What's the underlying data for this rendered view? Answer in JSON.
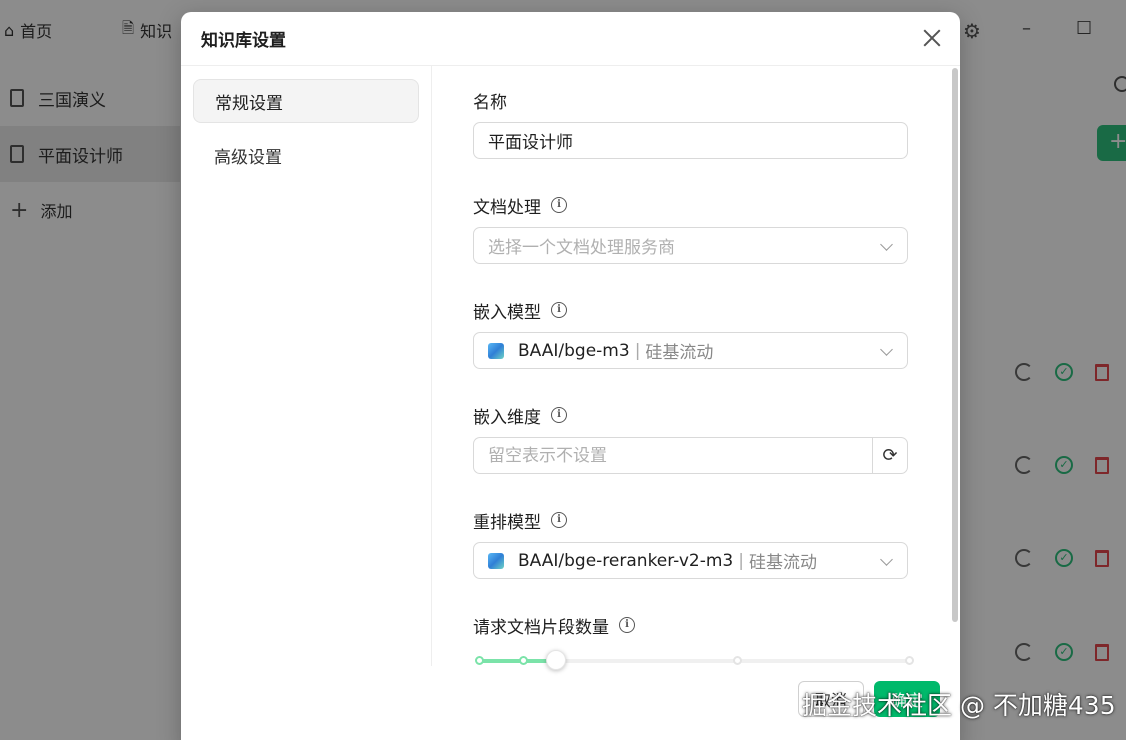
{
  "background": {
    "tabs": [
      {
        "label": "首页"
      },
      {
        "label": "知识"
      }
    ],
    "knowledge_bases": [
      {
        "label": "三国演义"
      },
      {
        "label": "平面设计师"
      }
    ],
    "add_label": "添加",
    "window_controls": {
      "minimize": "–",
      "maximize": "☐"
    }
  },
  "modal": {
    "title": "知识库设置",
    "nav": [
      {
        "label": "常规设置",
        "active": true
      },
      {
        "label": "高级设置",
        "active": false
      }
    ],
    "fields": {
      "name": {
        "label": "名称",
        "value": "平面设计师"
      },
      "doc_processing": {
        "label": "文档处理",
        "placeholder": "选择一个文档处理服务商"
      },
      "embedding_model": {
        "label": "嵌入模型",
        "model": "BAAI/bge-m3",
        "separator": "|",
        "provider": "硅基流动"
      },
      "embedding_dim": {
        "label": "嵌入维度",
        "placeholder": "留空表示不设置"
      },
      "rerank_model": {
        "label": "重排模型",
        "model": "BAAI/bge-reranker-v2-m3",
        "separator": "|",
        "provider": "硅基流动"
      },
      "chunk_count": {
        "label": "请求文档片段数量",
        "value_fraction": 0.18
      }
    },
    "footer": {
      "cancel_label": "取消",
      "ok_label": "确定"
    }
  },
  "watermark": "掘金技术社区 @ 不加糖435",
  "colors": {
    "accent": "#00b96b",
    "slider_track": "#7be3a9"
  }
}
